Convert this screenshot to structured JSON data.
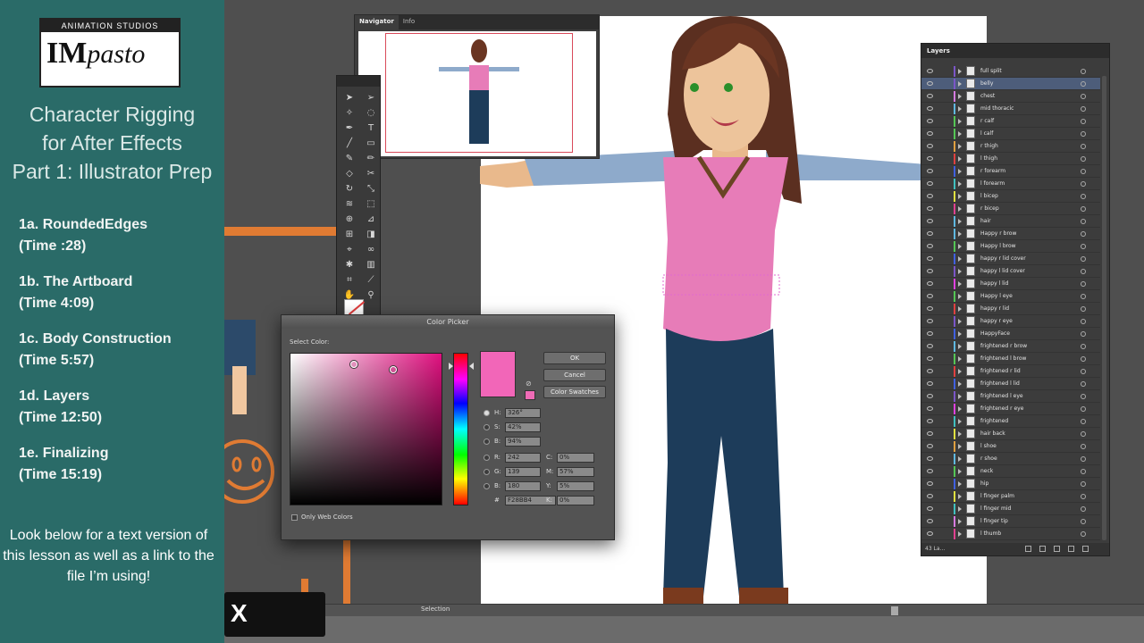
{
  "tutorial": {
    "logo": {
      "top": "ANIMATION STUDIOS",
      "main_im": "IM",
      "main_pasto": "pasto"
    },
    "title_lines": [
      "Character Rigging",
      "for After Effects",
      "Part 1: Illustrator Prep"
    ],
    "outline": [
      {
        "name": "1a. RoundedEdges",
        "time": "(Time :28)"
      },
      {
        "name": "1b. The Artboard",
        "time": "(Time 4:09)"
      },
      {
        "name": "1c. Body Construction",
        "time": "(Time 5:57)"
      },
      {
        "name": "1d. Layers",
        "time": "(Time 12:50)"
      },
      {
        "name": "1e. Finalizing",
        "time": "(Time 15:19)"
      }
    ],
    "closing_note": "Look below for a text version of this lesson as well as a link to the file I’m using!"
  },
  "close_overlay": {
    "glyph": "X"
  },
  "navigator": {
    "tabs": [
      "Navigator",
      "Info"
    ]
  },
  "status_bar": {
    "tool_label": "Selection"
  },
  "color_picker": {
    "title": "Color Picker",
    "select_label": "Select Color:",
    "buttons": {
      "ok": "OK",
      "cancel": "Cancel",
      "swatches": "Color Swatches"
    },
    "only_web": "Only Web Colors",
    "hsb": {
      "h": "326°",
      "s": "42%",
      "b": "94%"
    },
    "rgb": {
      "r": "242",
      "g": "139",
      "b": "180"
    },
    "cmyk": {
      "c": "0%",
      "m": "57%",
      "y": "5%",
      "k": "0%"
    },
    "hex": "F28BB4",
    "new_color": "#f266b8"
  },
  "layers": {
    "title": "Layers",
    "count": "43 La...",
    "items": [
      {
        "name": "full split",
        "color": "#7b56c8"
      },
      {
        "name": "belly",
        "color": "#7b56c8",
        "selected": true
      },
      {
        "name": "chest",
        "color": "#d67be0"
      },
      {
        "name": "mid thoracic",
        "color": "#5fb8e0"
      },
      {
        "name": "r calf",
        "color": "#55c655"
      },
      {
        "name": "l calf",
        "color": "#55c655"
      },
      {
        "name": "r thigh",
        "color": "#e0a040"
      },
      {
        "name": "l thigh",
        "color": "#e04040"
      },
      {
        "name": "r forearm",
        "color": "#4060e0"
      },
      {
        "name": "l forearm",
        "color": "#40c0c0"
      },
      {
        "name": "l bicep",
        "color": "#e0e040"
      },
      {
        "name": "r bicep",
        "color": "#e04090"
      },
      {
        "name": "hair",
        "color": "#5fb8e0"
      },
      {
        "name": "Happy r brow",
        "color": "#5fb8e0"
      },
      {
        "name": "Happy l brow",
        "color": "#55c655"
      },
      {
        "name": "happy r lid cover",
        "color": "#4060e0"
      },
      {
        "name": "happy l lid cover",
        "color": "#7b56c8"
      },
      {
        "name": "happy l lid",
        "color": "#e040e0"
      },
      {
        "name": "Happy l eye",
        "color": "#55c655"
      },
      {
        "name": "happy r lid",
        "color": "#e04040"
      },
      {
        "name": "happy r eye",
        "color": "#7b56c8"
      },
      {
        "name": "HappyFace",
        "color": "#4060e0"
      },
      {
        "name": "frightened r brow",
        "color": "#5fb8e0"
      },
      {
        "name": "frightened l brow",
        "color": "#55c655"
      },
      {
        "name": "frightened r lid",
        "color": "#e04040"
      },
      {
        "name": "frightened l lid",
        "color": "#4060e0"
      },
      {
        "name": "frightened l eye",
        "color": "#7b56c8"
      },
      {
        "name": "frightened r eye",
        "color": "#e040e0"
      },
      {
        "name": "frightened",
        "color": "#40c0c0"
      },
      {
        "name": "hair back",
        "color": "#e0e040"
      },
      {
        "name": "l shoe",
        "color": "#e0a040"
      },
      {
        "name": "r shoe",
        "color": "#5fb8e0"
      },
      {
        "name": "neck",
        "color": "#55c655"
      },
      {
        "name": "hip",
        "color": "#4060e0"
      },
      {
        "name": "l finger palm",
        "color": "#e0e040"
      },
      {
        "name": "l finger mid",
        "color": "#40c0c0"
      },
      {
        "name": "l finger tip",
        "color": "#d67be0"
      },
      {
        "name": "l thumb",
        "color": "#e04090"
      }
    ]
  }
}
